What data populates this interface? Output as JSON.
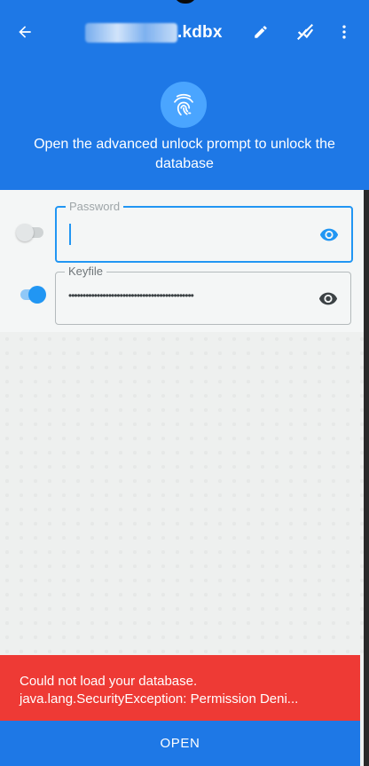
{
  "toolbar": {
    "title": ".kdbx",
    "back_icon": "arrow-left-icon",
    "edit_icon": "pencil-icon",
    "lock_icon": "lock-off-icon",
    "menu_icon": "more-vert-icon"
  },
  "unlock": {
    "fingerprint_icon": "fingerprint-icon",
    "prompt": "Open the advanced unlock prompt to unlock the database"
  },
  "password": {
    "label": "Password",
    "value": "",
    "toggle_on": false
  },
  "keyfile": {
    "label": "Keyfile",
    "value": "••••••••••••••••••••••••••••••••••••••••••••",
    "toggle_on": true
  },
  "error": {
    "line1": "Could not load your database.",
    "line2": "java.lang.SecurityException: Permission Deni..."
  },
  "open_button": {
    "label": "OPEN"
  },
  "colors": {
    "primary": "#1e78e6",
    "accent_blue": "#2196f3",
    "error_red": "#ee3a35",
    "panel_bg": "#f4f6f6"
  }
}
